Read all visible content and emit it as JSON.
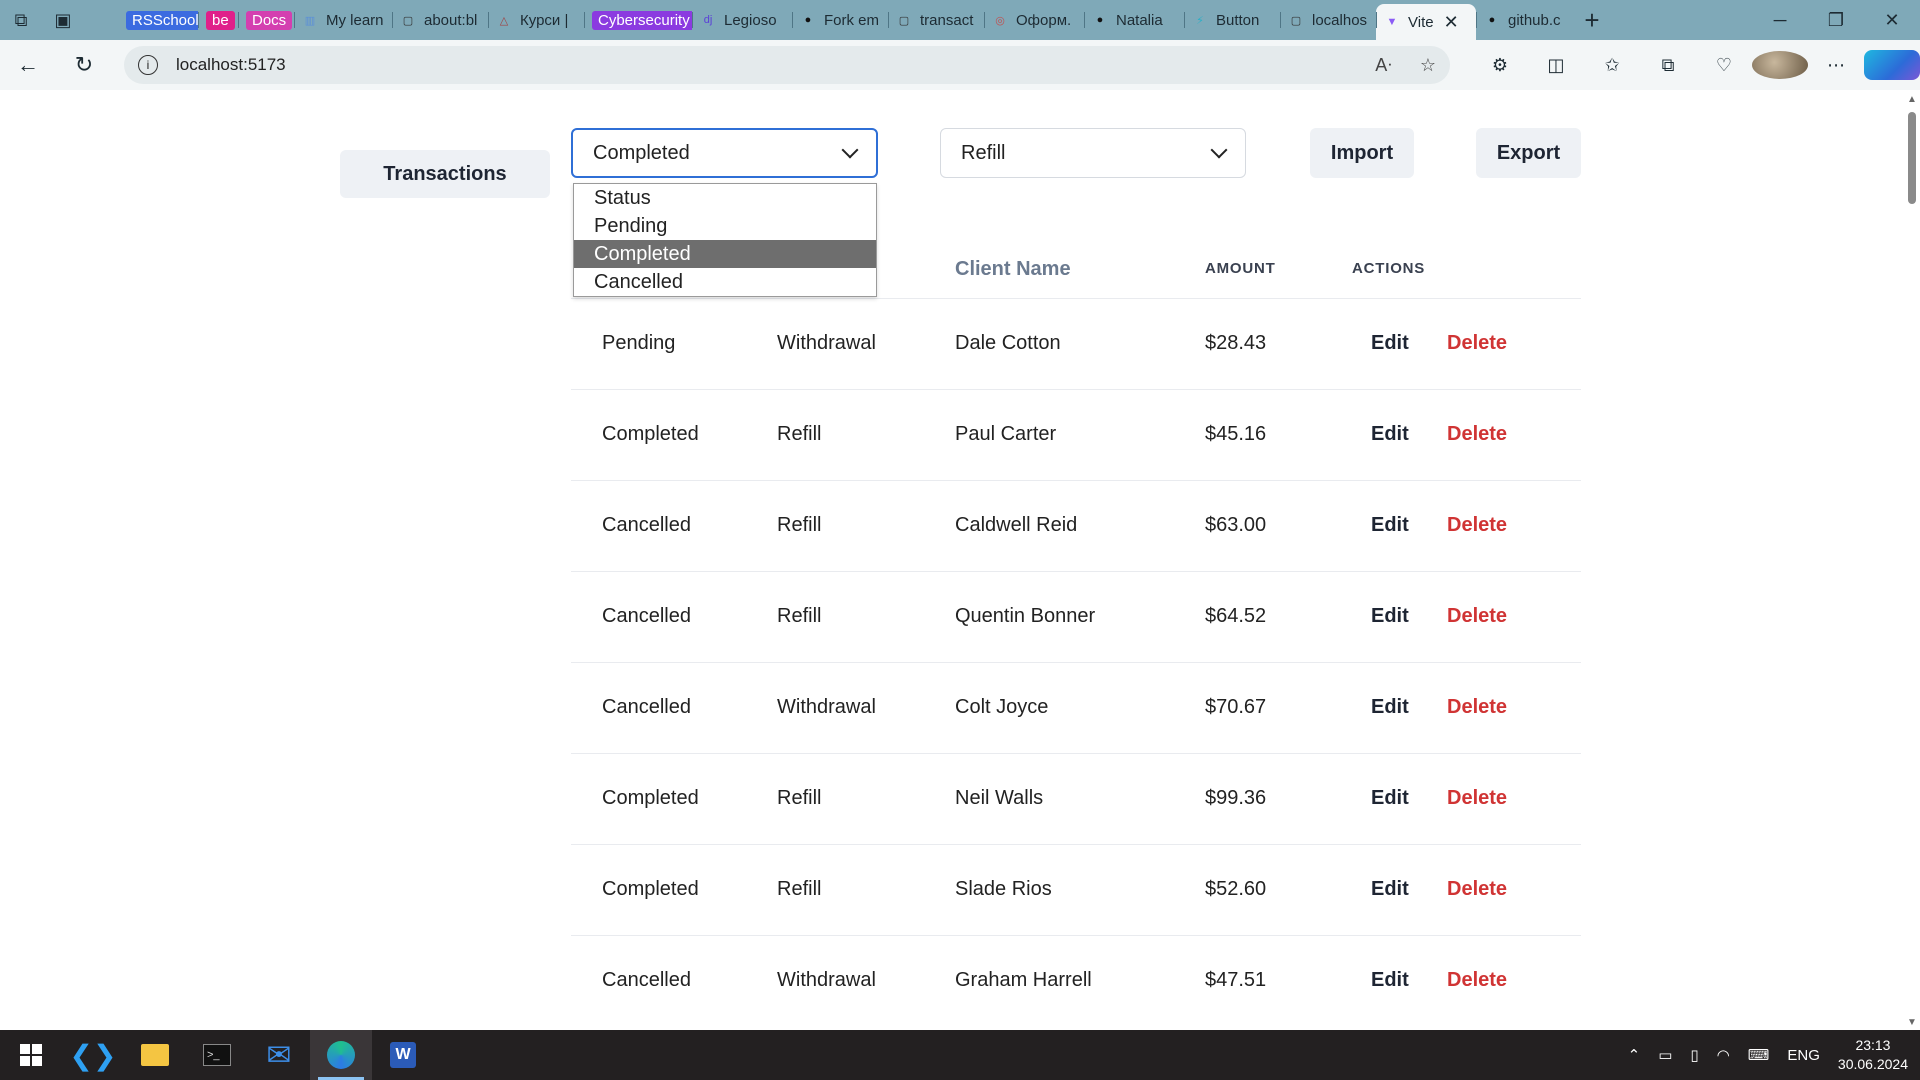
{
  "browser": {
    "tabs": [
      {
        "label": "RSSchool",
        "style": "pill",
        "pill_color": "#3b6be0"
      },
      {
        "label": "be",
        "style": "pill",
        "pill_color": "#e0208a"
      },
      {
        "label": "Docs",
        "style": "pill",
        "pill_color": "#d43fb0"
      },
      {
        "label": "My learn",
        "icon": "trello-icon"
      },
      {
        "label": "about:bl",
        "icon": "page-icon"
      },
      {
        "label": "Курси |",
        "icon": "triangle-icon"
      },
      {
        "label": "Cybersecurity",
        "style": "pill",
        "pill_color": "#8b3be0"
      },
      {
        "label": "Legioso",
        "icon": "dj-icon"
      },
      {
        "label": "Fork em",
        "icon": "github-icon"
      },
      {
        "label": "transact",
        "icon": "page-icon"
      },
      {
        "label": "Оформ.",
        "icon": "web-icon"
      },
      {
        "label": "Natalia",
        "icon": "github-icon"
      },
      {
        "label": "Button",
        "icon": "lightning-icon"
      },
      {
        "label": "localhos",
        "icon": "page-icon"
      },
      {
        "label": "Vite",
        "icon": "vite-icon",
        "active": true
      },
      {
        "label": "github.c",
        "icon": "github-icon"
      }
    ],
    "url": "localhost:5173"
  },
  "page": {
    "sidebar_button": "Transactions",
    "status_select": {
      "value": "Completed",
      "options": [
        "Status",
        "Pending",
        "Completed",
        "Cancelled"
      ],
      "selected_index": 2
    },
    "type_select": {
      "value": "Refill"
    },
    "import_label": "Import",
    "export_label": "Export",
    "table": {
      "headers": {
        "client": "Client Name",
        "amount": "AMOUNT",
        "actions": "ACTIONS"
      },
      "rows": [
        {
          "status": "Pending",
          "type": "Withdrawal",
          "client": "Dale Cotton",
          "amount": "$28.43"
        },
        {
          "status": "Completed",
          "type": "Refill",
          "client": "Paul Carter",
          "amount": "$45.16"
        },
        {
          "status": "Cancelled",
          "type": "Refill",
          "client": "Caldwell Reid",
          "amount": "$63.00"
        },
        {
          "status": "Cancelled",
          "type": "Refill",
          "client": "Quentin Bonner",
          "amount": "$64.52"
        },
        {
          "status": "Cancelled",
          "type": "Withdrawal",
          "client": "Colt Joyce",
          "amount": "$70.67"
        },
        {
          "status": "Completed",
          "type": "Refill",
          "client": "Neil Walls",
          "amount": "$99.36"
        },
        {
          "status": "Completed",
          "type": "Refill",
          "client": "Slade Rios",
          "amount": "$52.60"
        },
        {
          "status": "Cancelled",
          "type": "Withdrawal",
          "client": "Graham Harrell",
          "amount": "$47.51"
        }
      ],
      "edit_label": "Edit",
      "delete_label": "Delete"
    }
  },
  "taskbar": {
    "lang": "ENG",
    "time": "23:13",
    "date": "30.06.2024"
  },
  "colors": {
    "accent": "#2f6fd6",
    "delete": "#d03434",
    "selected_option": "#6e6e6e"
  }
}
